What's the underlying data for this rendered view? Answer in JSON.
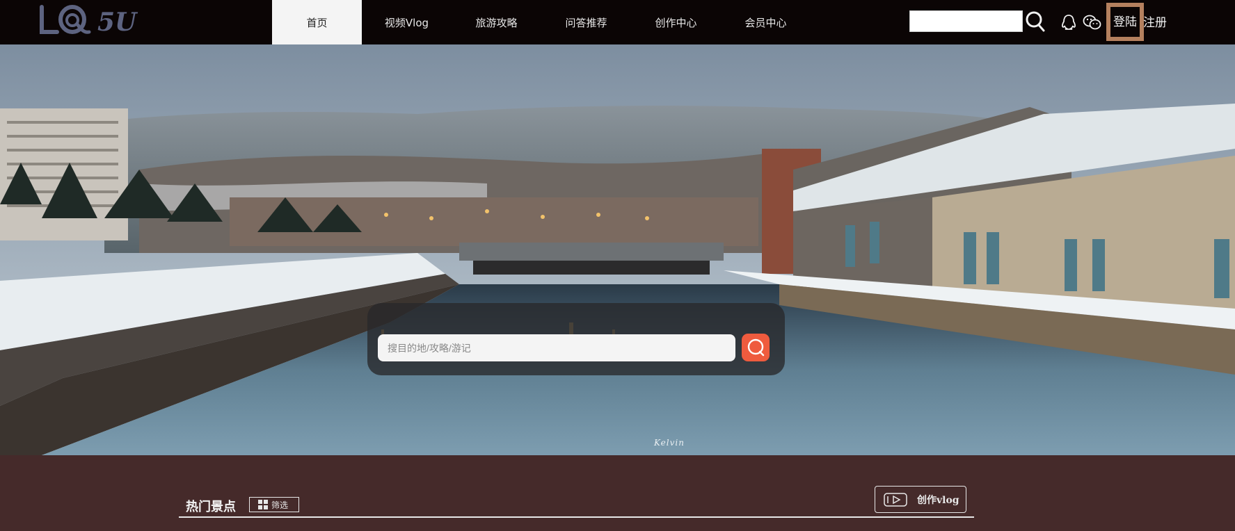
{
  "brand": {
    "logo_text": "5U"
  },
  "nav": {
    "items": [
      {
        "label": "首页",
        "active": true
      },
      {
        "label": "视频Vlog",
        "active": false
      },
      {
        "label": "旅游攻略",
        "active": false
      },
      {
        "label": "问答推荐",
        "active": false
      },
      {
        "label": "创作中心",
        "active": false
      },
      {
        "label": "会员中心",
        "active": false
      }
    ]
  },
  "header": {
    "search": {
      "value": "",
      "placeholder": ""
    },
    "search_icon": "search-icon",
    "qq_icon": "qq-penguin-icon",
    "wechat_icon": "wechat-icon",
    "login_label": "登陆",
    "register_label": "注册",
    "login_highlight_color": "#b4805e"
  },
  "hero": {
    "search": {
      "placeholder": "搜目的地/攻略/游记",
      "value": ""
    },
    "search_button_icon": "search-icon",
    "search_button_color": "#ef5b3e",
    "photo_credit": "Kelvin"
  },
  "section": {
    "title": "热门景点",
    "filter_label": "筛选",
    "filter_icon": "grid-icon",
    "create_label": "创作vlog",
    "create_icon": "video-play-icon",
    "background_color": "#452a2a"
  }
}
